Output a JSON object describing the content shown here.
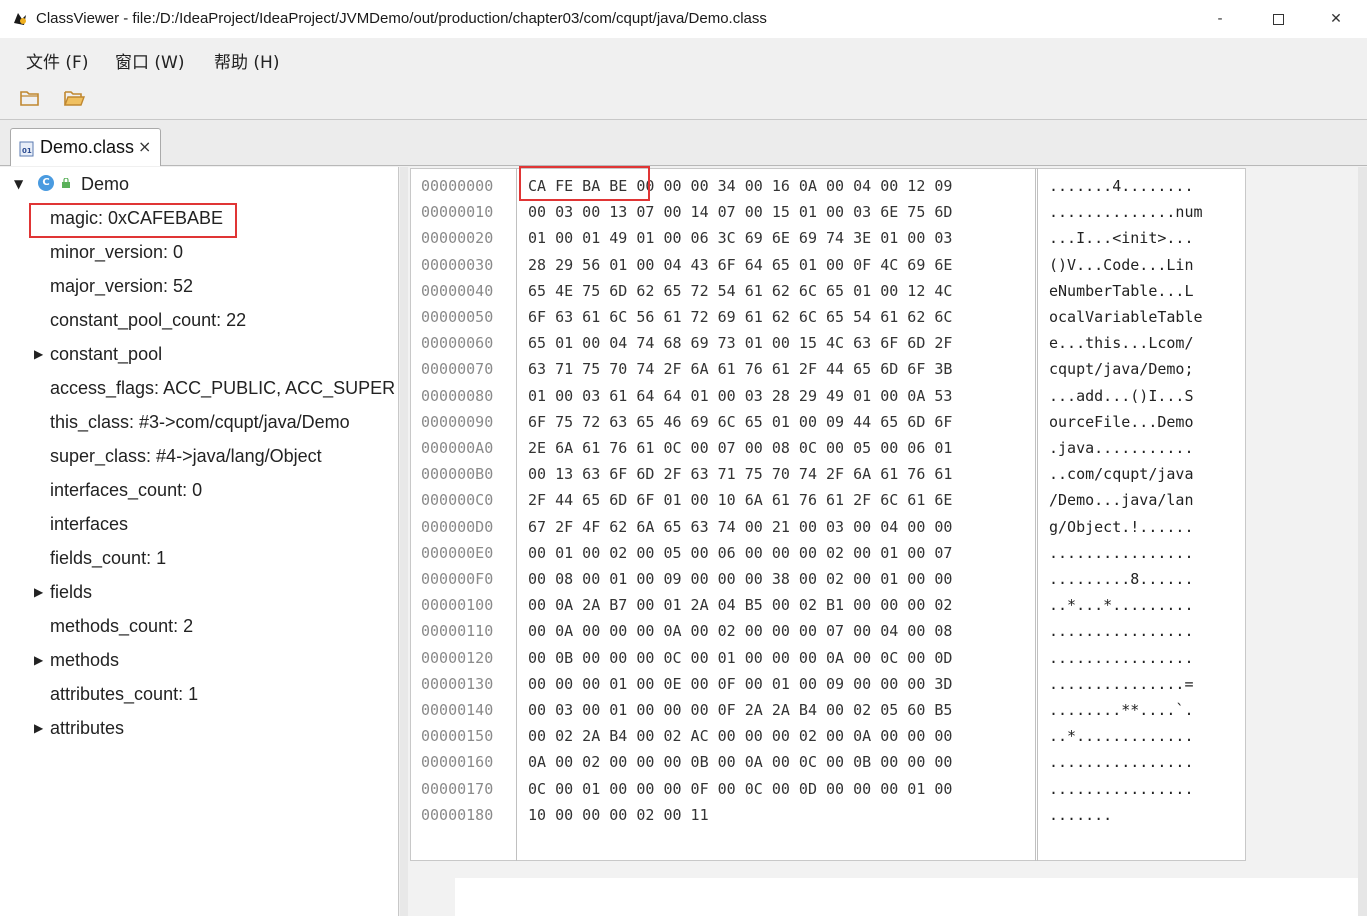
{
  "window": {
    "title": "ClassViewer - file:/D:/IdeaProject/IdeaProject/JVMDemo/out/production/chapter03/com/cqupt/java/Demo.class",
    "minimize_glyph": "‐",
    "close_glyph": "✕"
  },
  "menu": {
    "items": [
      "文件 (F)",
      "窗口 (W)",
      "帮助 (H)"
    ]
  },
  "toolbar": {
    "icons": [
      "folder-icon",
      "open-folder-icon"
    ]
  },
  "tab": {
    "label": "Demo.class",
    "close": "×",
    "icon_text": "01"
  },
  "tree": {
    "root": "Demo",
    "root_icon_letter": "C",
    "items": [
      "magic: 0xCAFEBABE",
      "minor_version: 0",
      "major_version: 52",
      "constant_pool_count: 22",
      "constant_pool",
      "access_flags: ACC_PUBLIC, ACC_SUPER",
      "this_class: #3->com/cqupt/java/Demo",
      "super_class: #4->java/lang/Object",
      "interfaces_count: 0",
      "interfaces",
      "fields_count: 1",
      "fields",
      "methods_count: 2",
      "methods",
      "attributes_count: 1",
      "attributes"
    ],
    "expand_glyph": "▶",
    "root_expand_glyph": "▼"
  },
  "hex": {
    "offsets": [
      "00000000",
      "00000010",
      "00000020",
      "00000030",
      "00000040",
      "00000050",
      "00000060",
      "00000070",
      "00000080",
      "00000090",
      "000000A0",
      "000000B0",
      "000000C0",
      "000000D0",
      "000000E0",
      "000000F0",
      "00000100",
      "00000110",
      "00000120",
      "00000130",
      "00000140",
      "00000150",
      "00000160",
      "00000170",
      "00000180"
    ],
    "rows": [
      "CA FE BA BE 00 00 00 34 00 16 0A 00 04 00 12 09",
      "00 03 00 13 07 00 14 07 00 15 01 00 03 6E 75 6D",
      "01 00 01 49 01 00 06 3C 69 6E 69 74 3E 01 00 03",
      "28 29 56 01 00 04 43 6F 64 65 01 00 0F 4C 69 6E",
      "65 4E 75 6D 62 65 72 54 61 62 6C 65 01 00 12 4C",
      "6F 63 61 6C 56 61 72 69 61 62 6C 65 54 61 62 6C",
      "65 01 00 04 74 68 69 73 01 00 15 4C 63 6F 6D 2F",
      "63 71 75 70 74 2F 6A 61 76 61 2F 44 65 6D 6F 3B",
      "01 00 03 61 64 64 01 00 03 28 29 49 01 00 0A 53",
      "6F 75 72 63 65 46 69 6C 65 01 00 09 44 65 6D 6F",
      "2E 6A 61 76 61 0C 00 07 00 08 0C 00 05 00 06 01",
      "00 13 63 6F 6D 2F 63 71 75 70 74 2F 6A 61 76 61",
      "2F 44 65 6D 6F 01 00 10 6A 61 76 61 2F 6C 61 6E",
      "67 2F 4F 62 6A 65 63 74 00 21 00 03 00 04 00 00",
      "00 01 00 02 00 05 00 06 00 00 00 02 00 01 00 07",
      "00 08 00 01 00 09 00 00 00 38 00 02 00 01 00 00",
      "00 0A 2A B7 00 01 2A 04 B5 00 02 B1 00 00 00 02",
      "00 0A 00 00 00 0A 00 02 00 00 00 07 00 04 00 08",
      "00 0B 00 00 00 0C 00 01 00 00 00 0A 00 0C 00 0D",
      "00 00 00 01 00 0E 00 0F 00 01 00 09 00 00 00 3D",
      "00 03 00 01 00 00 00 0F 2A 2A B4 00 02 05 60 B5",
      "00 02 2A B4 00 02 AC 00 00 00 02 00 0A 00 00 00",
      "0A 00 02 00 00 00 0B 00 0A 00 0C 00 0B 00 00 00",
      "0C 00 01 00 00 00 0F 00 0C 00 0D 00 00 00 01 00",
      "10 00 00 00 02 00 11"
    ],
    "ascii": [
      ".......4........",
      "..............num",
      "...I...<init>...",
      "()V...Code...Lin",
      "eNumberTable...L",
      "ocalVariableTable",
      "e...this...Lcom/",
      "cqupt/java/Demo;",
      "...add...()I...S",
      "ourceFile...Demo",
      ".java...........",
      "..com/cqupt/java",
      "/Demo...java/lan",
      "g/Object.!......",
      "................",
      ".........8......",
      "..*...*.........",
      "................",
      "................",
      "...............=",
      "........**....`.",
      "..*.............",
      "................",
      "................",
      "......."
    ]
  },
  "colors": {
    "highlight": "#e03535",
    "class_icon": "#4a9be0",
    "offset_text": "#8a8a8a"
  }
}
